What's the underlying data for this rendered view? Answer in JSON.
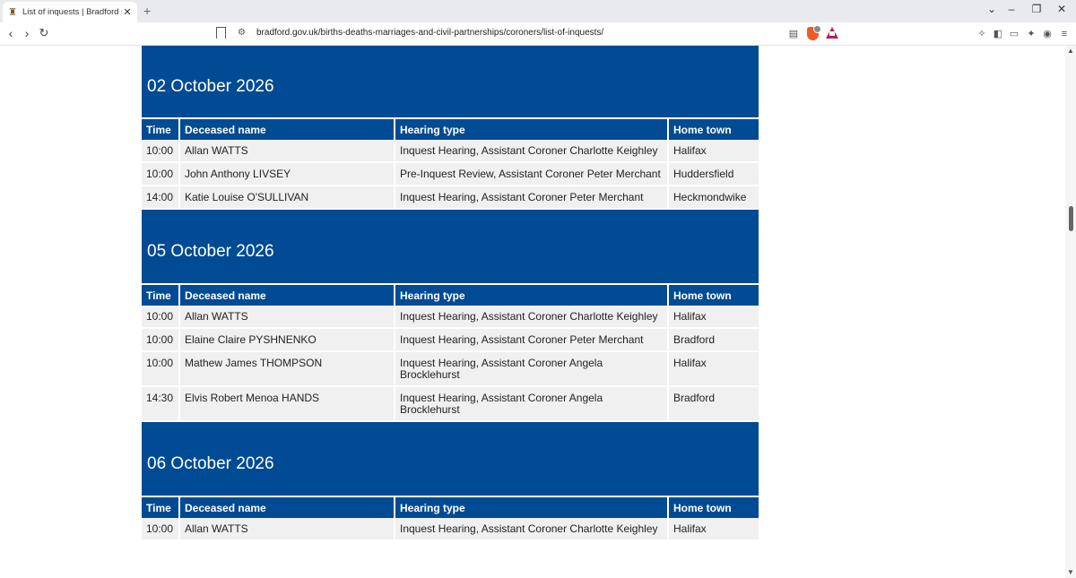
{
  "browser": {
    "tab_title": "List of inquests | Bradford Counc",
    "url": "bradford.gov.uk/births-deaths-marriages-and-civil-partnerships/coroners/list-of-inquests/"
  },
  "columns": {
    "time": "Time",
    "name": "Deceased name",
    "type": "Hearing type",
    "town": "Home town"
  },
  "sections": [
    {
      "date": "02 October 2026",
      "rows": [
        {
          "time": "10:00",
          "name": "Allan WATTS",
          "type": "Inquest Hearing, Assistant Coroner Charlotte Keighley",
          "town": "Halifax"
        },
        {
          "time": "10:00",
          "name": "John Anthony LIVSEY",
          "type": "Pre-Inquest Review, Assistant Coroner Peter Merchant",
          "town": "Huddersfield"
        },
        {
          "time": "14:00",
          "name": "Katie Louise O'SULLIVAN",
          "type": "Inquest Hearing, Assistant Coroner Peter Merchant",
          "town": "Heckmondwike"
        }
      ]
    },
    {
      "date": "05 October 2026",
      "rows": [
        {
          "time": "10:00",
          "name": "Allan WATTS",
          "type": "Inquest Hearing, Assistant Coroner Charlotte Keighley",
          "town": "Halifax"
        },
        {
          "time": "10:00",
          "name": "Elaine Claire PYSHNENKO",
          "type": "Inquest Hearing, Assistant Coroner Peter Merchant",
          "town": "Bradford"
        },
        {
          "time": "10:00",
          "name": "Mathew James THOMPSON",
          "type": "Inquest Hearing, Assistant Coroner Angela Brocklehurst",
          "town": "Halifax"
        },
        {
          "time": "14:30",
          "name": "Elvis Robert Menoa HANDS",
          "type": "Inquest Hearing, Assistant Coroner Angela Brocklehurst",
          "town": "Bradford"
        }
      ]
    },
    {
      "date": "06 October 2026",
      "rows": [
        {
          "time": "10:00",
          "name": "Allan WATTS",
          "type": "Inquest Hearing, Assistant Coroner Charlotte Keighley",
          "town": "Halifax"
        }
      ]
    }
  ]
}
